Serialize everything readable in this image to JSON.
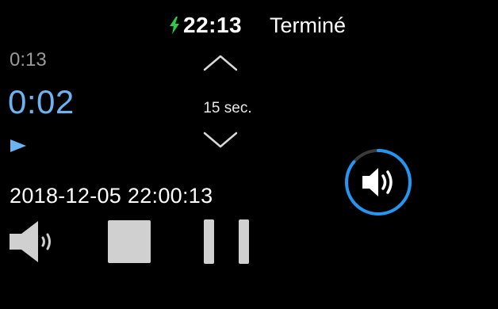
{
  "status_bar": {
    "time": "22:13",
    "done_label": "Terminé",
    "charging_color": "#2ecc40"
  },
  "player": {
    "elapsed": "0:13",
    "current": "0:02",
    "recorded_at": "2018-12-05 22:00:13",
    "accent_color": "#6db3f2"
  },
  "stepper": {
    "label": "15 sec."
  },
  "icons": {
    "charging": "bolt-icon",
    "play_indicator": "play-triangle-icon",
    "step_up": "chevron-up-icon",
    "step_down": "chevron-down-icon",
    "volume": "speaker-wave-icon",
    "stop": "stop-square-icon",
    "pause": "pause-bars-icon"
  },
  "volume_ring": {
    "progress": 0.86,
    "color": "#2196f3"
  }
}
